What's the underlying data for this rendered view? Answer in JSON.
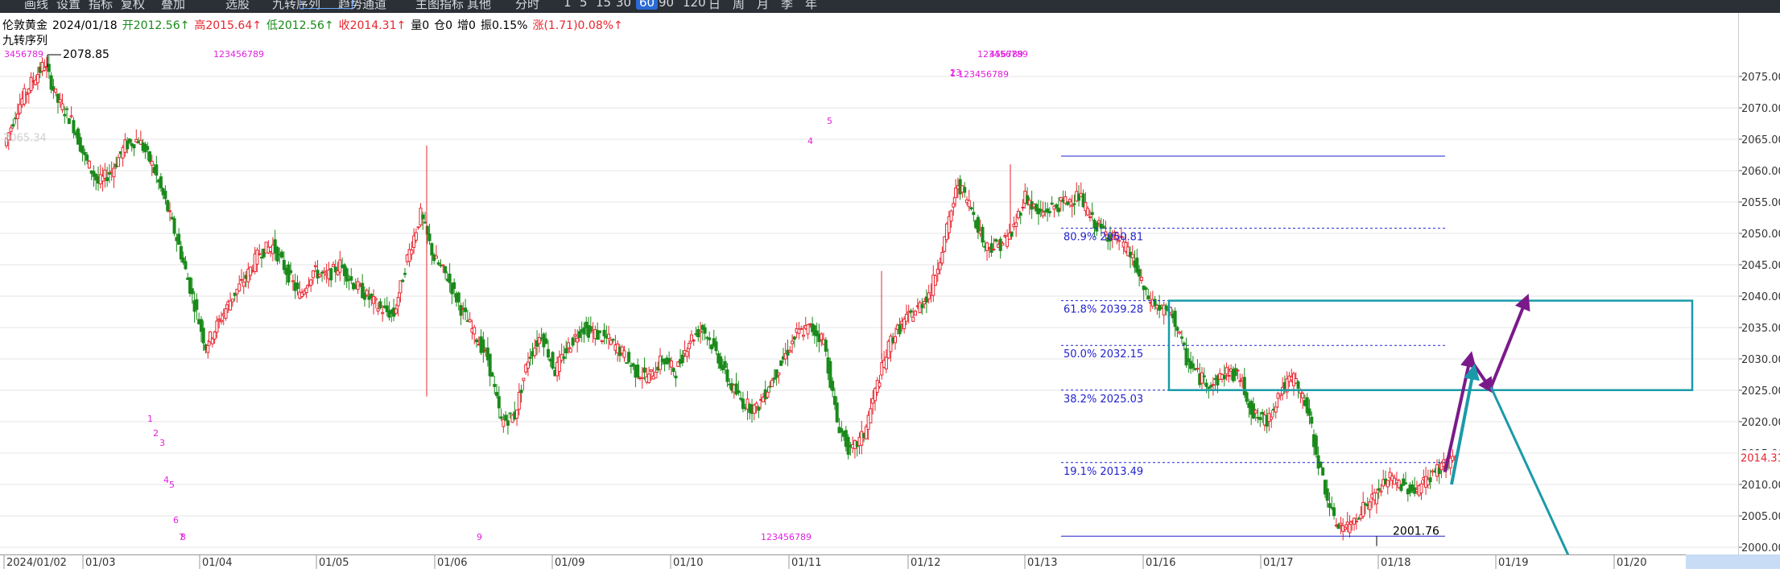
{
  "toolbar": {
    "items": [
      "画线",
      "设置",
      "指标",
      "复权",
      "叠加",
      "选股",
      "九转序列",
      "趋势通道",
      "主图指标",
      "其他",
      "分时",
      "1",
      "5",
      "15",
      "30",
      "60",
      "90",
      "120",
      "日",
      "周",
      "月",
      "季",
      "年"
    ],
    "active": "60"
  },
  "info": {
    "name": "伦敦黄金",
    "date": "2024/01/18",
    "open": "开2012.56↑",
    "high": "高2015.64↑",
    "low": "低2012.56↑",
    "close": "收2014.31↑",
    "volume": "量0",
    "position": "仓0",
    "increase": "增0",
    "amplitude": "振0.15%",
    "change": "涨(1.71)0.08%↑"
  },
  "indicator": {
    "name": "九转序列"
  },
  "price_axis": {
    "labels": [
      "2075.00",
      "2070.00",
      "2065.00",
      "2060.00",
      "2055.00",
      "2050.00",
      "2045.00",
      "2040.00",
      "2035.00",
      "2030.00",
      "2025.00",
      "2020.00",
      "2015.00",
      "2010.00",
      "2005.00",
      "2000.00"
    ],
    "current_price": "2014.31"
  },
  "date_axis": {
    "labels": [
      "2024/01/02",
      "01/03",
      "01/04",
      "01/05",
      "01/06",
      "01/09",
      "01/10",
      "01/11",
      "01/12",
      "01/13",
      "01/16",
      "01/17",
      "01/18",
      "01/19",
      "01/20"
    ]
  },
  "period_label": "60分钟",
  "markers": {
    "high": "2078.85",
    "low": "2001.76",
    "left_faded": "2065.34"
  },
  "fib_levels": [
    {
      "label": "80.9% 2050.81",
      "price": 2050.81
    },
    {
      "label": "61.8% 2039.28",
      "price": 2039.28
    },
    {
      "label": "50.0% 2032.15",
      "price": 2032.15
    },
    {
      "label": "38.2% 2025.03",
      "price": 2025.03
    },
    {
      "label": "19.1% 2013.49",
      "price": 2013.49
    }
  ],
  "fib_range": {
    "top": 2062.3,
    "bottom": 2001.76
  },
  "td_sequences": [
    "3456789",
    "123456789",
    "1",
    "2",
    "3",
    "4",
    "5",
    "6",
    "7",
    "8",
    "9",
    "123456789",
    "123456789",
    "123456789",
    "4",
    "5",
    "23",
    "456789",
    "1"
  ],
  "colors": {
    "up": "#e8252e",
    "down": "#1a8a1a",
    "fib": "#2222cc",
    "zone": "#1a9aa8",
    "arrow_purple": "#7a1a8a",
    "arrow_teal": "#1a9aa8",
    "td": "#e020e0"
  },
  "chart_data": {
    "type": "candlestick",
    "symbol": "伦敦黄金",
    "period": "60分钟",
    "ylim": [
      1999.0,
      2079.0
    ],
    "high": 2078.85,
    "low": 2001.76,
    "last": 2014.31,
    "path_prices": [
      2064,
      2070,
      2074,
      2077,
      2071,
      2068,
      2062,
      2058,
      2060,
      2064,
      2065,
      2061,
      2055,
      2048,
      2040,
      2032,
      2036,
      2040,
      2043,
      2047,
      2048,
      2044,
      2040,
      2044,
      2043,
      2045,
      2042,
      2040,
      2038,
      2037,
      2046,
      2053,
      2046,
      2043,
      2038,
      2034,
      2030,
      2020,
      2021,
      2030,
      2034,
      2028,
      2032,
      2035,
      2034,
      2033,
      2031,
      2028,
      2027,
      2030,
      2028,
      2033,
      2035,
      2031,
      2026,
      2023,
      2022,
      2026,
      2030,
      2034,
      2035,
      2033,
      2020,
      2015,
      2018,
      2026,
      2033,
      2036,
      2038,
      2041,
      2049,
      2058,
      2054,
      2048,
      2048,
      2050,
      2056,
      2053,
      2054,
      2055,
      2056,
      2052,
      2050,
      2049,
      2046,
      2040,
      2038,
      2037,
      2030,
      2027,
      2026,
      2028,
      2027,
      2021,
      2020,
      2025,
      2027,
      2022,
      2012,
      2004,
      2003,
      2006,
      2008,
      2011,
      2010,
      2009,
      2011,
      2013,
      2014.31
    ]
  }
}
